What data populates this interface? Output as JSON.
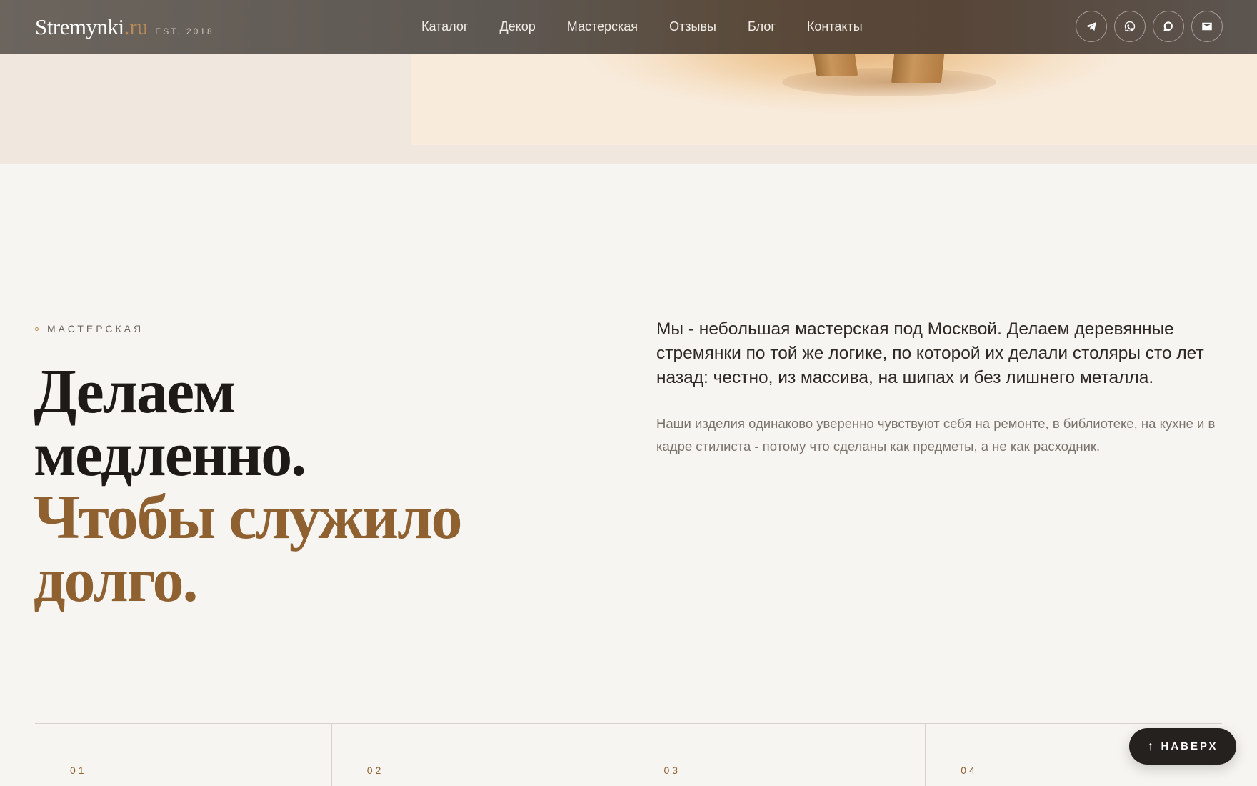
{
  "header": {
    "brand_name": "Stremynki",
    "brand_tld": ".ru",
    "brand_est": "EST. 2018",
    "nav": [
      "Каталог",
      "Декор",
      "Мастерская",
      "Отзывы",
      "Блог",
      "Контакты"
    ],
    "socials": [
      "telegram-icon",
      "whatsapp-icon",
      "chat-icon",
      "mail-icon"
    ]
  },
  "about": {
    "eyebrow": "МАСТЕРСКАЯ",
    "headline_dark_1": "Делаем",
    "headline_dark_2": "медленно.",
    "headline_accent_1": "Чтобы служило",
    "headline_accent_2": "долго.",
    "lead": "Мы - небольшая мастерская под Москвой. Делаем деревянные стремянки по той же логике, по которой их делали столяры сто лет назад: честно, из массива, на шипах и без лишнего металла.",
    "body": "Наши изделия одинаково уверенно чувствуют себя на ремонте, в библиотеке, на кухне и в кадре стилиста - потому что сделаны как предметы, а не как расходник."
  },
  "features": [
    "01",
    "02",
    "03",
    "04"
  ],
  "to_top": {
    "arrow": "↑",
    "label": "НАВЕРХ"
  },
  "colors": {
    "accent": "#8f6131",
    "dark": "#1d1a17",
    "background": "#f7f5f1"
  }
}
